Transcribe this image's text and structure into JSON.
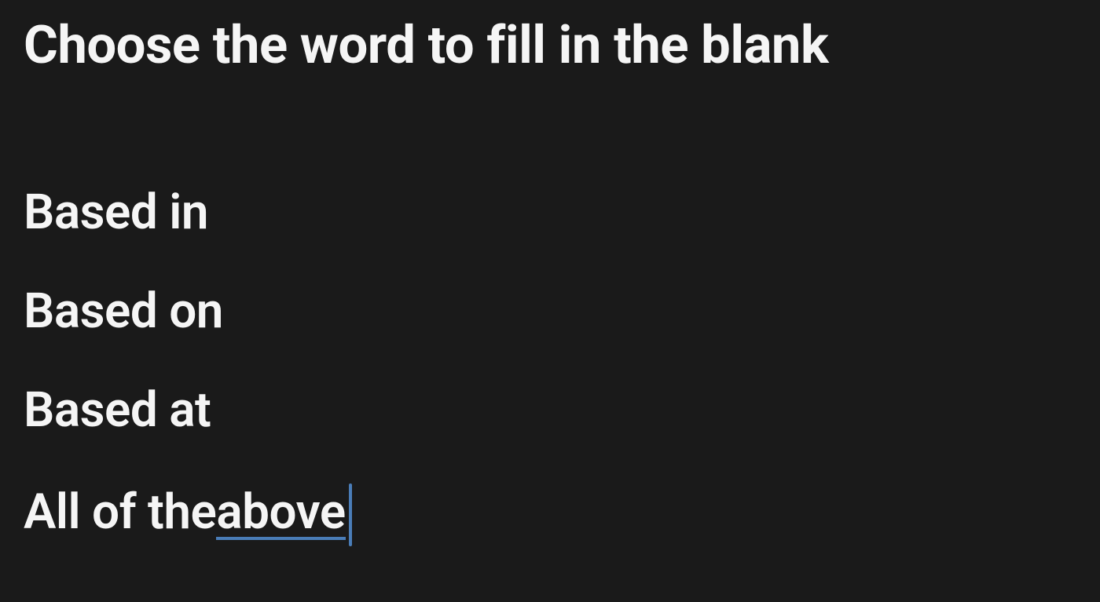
{
  "prompt": "Choose the word to fill in the blank",
  "options": [
    {
      "label": "Based in"
    },
    {
      "label": "Based on"
    },
    {
      "label": "Based at"
    }
  ],
  "editing_option": {
    "prefix": "All of the ",
    "underlined": "above"
  }
}
